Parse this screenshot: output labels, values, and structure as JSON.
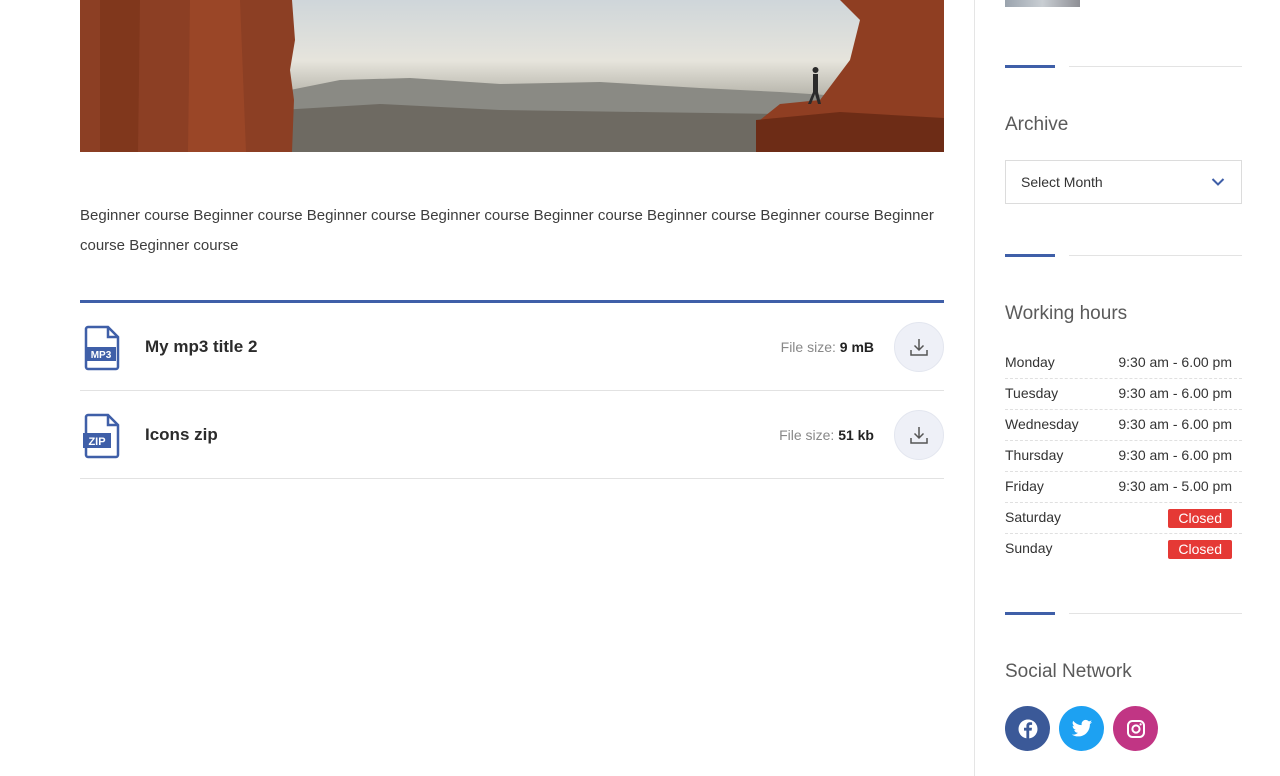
{
  "main": {
    "description": "Beginner course Beginner course Beginner course Beginner course Beginner course Beginner course Beginner course Beginner course Beginner course",
    "files": [
      {
        "title": "My mp3 title 2",
        "size_label": "File size:",
        "size_value": "9 mB",
        "icon": "mp3-file-icon",
        "icon_text": "MP3"
      },
      {
        "title": "Icons zip",
        "size_label": "File size:",
        "size_value": "51 kb",
        "icon": "zip-file-icon",
        "icon_text": "ZIP"
      }
    ]
  },
  "sidebar": {
    "archive": {
      "heading": "Archive",
      "select_value": "Select Month"
    },
    "hours": {
      "heading": "Working hours",
      "rows": [
        {
          "day": "Monday",
          "time": "9:30 am - 6.00 pm"
        },
        {
          "day": "Tuesday",
          "time": "9:30 am - 6.00 pm"
        },
        {
          "day": "Wednesday",
          "time": "9:30 am - 6.00 pm"
        },
        {
          "day": "Thursday",
          "time": "9:30 am - 6.00 pm"
        },
        {
          "day": "Friday",
          "time": "9:30 am - 5.00 pm"
        },
        {
          "day": "Saturday",
          "closed": "Closed"
        },
        {
          "day": "Sunday",
          "closed": "Closed"
        }
      ]
    },
    "social": {
      "heading": "Social Network",
      "items": [
        {
          "icon": "facebook-icon",
          "color": "#3b5998"
        },
        {
          "icon": "twitter-icon",
          "color": "#1da1f2"
        },
        {
          "icon": "instagram-icon",
          "color": "#c13584"
        }
      ]
    }
  },
  "colors": {
    "accent": "#3f5fa8",
    "closed_badge": "#e53935"
  }
}
